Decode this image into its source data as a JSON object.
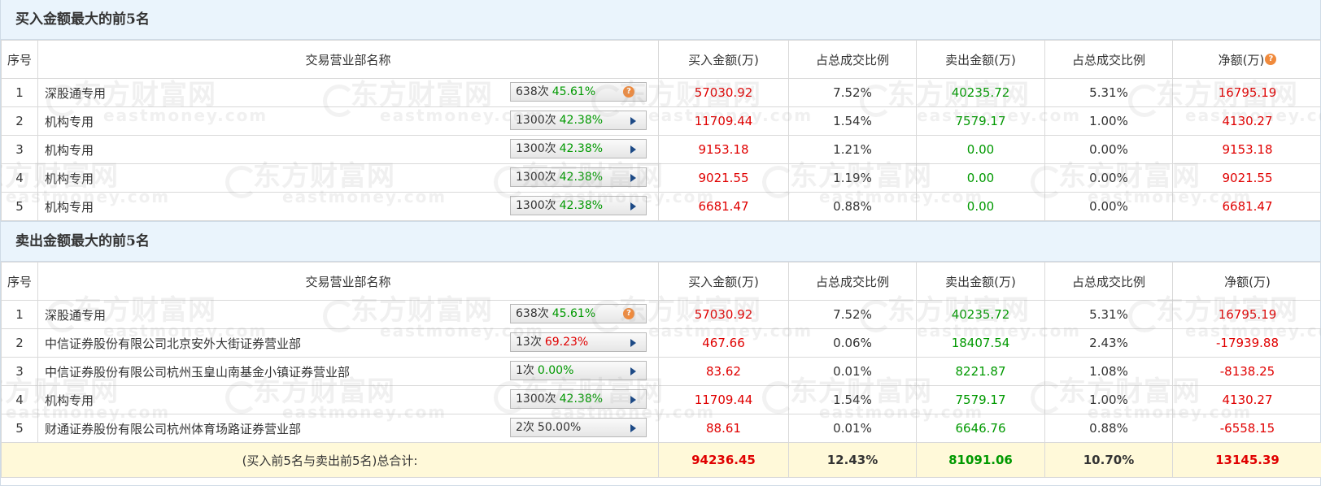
{
  "headers": {
    "seq": "序号",
    "name": "交易营业部名称",
    "buy": "买入金额(万)",
    "buy_ratio": "占总成交比例",
    "sell": "卖出金额(万)",
    "sell_ratio": "占总成交比例",
    "net": "净额(万)"
  },
  "buy_section": {
    "title": "买入金额最大的前5名",
    "rows": [
      {
        "seq": "1",
        "name": "深股通专用",
        "count": "638次",
        "pct": "45.61%",
        "pct_color": "green",
        "icon": "question-icon",
        "buy": "57030.92",
        "buy_ratio": "7.52%",
        "sell": "40235.72",
        "sell_ratio": "5.31%",
        "net": "16795.19"
      },
      {
        "seq": "2",
        "name": "机构专用",
        "count": "1300次",
        "pct": "42.38%",
        "pct_color": "green",
        "icon": "play-arrow-icon",
        "buy": "11709.44",
        "buy_ratio": "1.54%",
        "sell": "7579.17",
        "sell_ratio": "1.00%",
        "net": "4130.27"
      },
      {
        "seq": "3",
        "name": "机构专用",
        "count": "1300次",
        "pct": "42.38%",
        "pct_color": "green",
        "icon": "play-arrow-icon",
        "buy": "9153.18",
        "buy_ratio": "1.21%",
        "sell": "0.00",
        "sell_ratio": "0.00%",
        "net": "9153.18"
      },
      {
        "seq": "4",
        "name": "机构专用",
        "count": "1300次",
        "pct": "42.38%",
        "pct_color": "green",
        "icon": "play-arrow-icon",
        "buy": "9021.55",
        "buy_ratio": "1.19%",
        "sell": "0.00",
        "sell_ratio": "0.00%",
        "net": "9021.55"
      },
      {
        "seq": "5",
        "name": "机构专用",
        "count": "1300次",
        "pct": "42.38%",
        "pct_color": "green",
        "icon": "play-arrow-icon",
        "buy": "6681.47",
        "buy_ratio": "0.88%",
        "sell": "0.00",
        "sell_ratio": "0.00%",
        "net": "6681.47"
      }
    ]
  },
  "sell_section": {
    "title": "卖出金额最大的前5名",
    "rows": [
      {
        "seq": "1",
        "name": "深股通专用",
        "count": "638次",
        "pct": "45.61%",
        "pct_color": "green",
        "icon": "question-icon",
        "buy": "57030.92",
        "buy_ratio": "7.52%",
        "sell": "40235.72",
        "sell_ratio": "5.31%",
        "net": "16795.19"
      },
      {
        "seq": "2",
        "name": "中信证券股份有限公司北京安外大街证券营业部",
        "count": "13次",
        "pct": "69.23%",
        "pct_color": "red",
        "icon": "play-arrow-icon",
        "buy": "467.66",
        "buy_ratio": "0.06%",
        "sell": "18407.54",
        "sell_ratio": "2.43%",
        "net": "-17939.88"
      },
      {
        "seq": "3",
        "name": "中信证券股份有限公司杭州玉皇山南基金小镇证券营业部",
        "count": "1次",
        "pct": "0.00%",
        "pct_color": "green",
        "icon": "play-arrow-icon",
        "buy": "83.62",
        "buy_ratio": "0.01%",
        "sell": "8221.87",
        "sell_ratio": "1.08%",
        "net": "-8138.25"
      },
      {
        "seq": "4",
        "name": "机构专用",
        "count": "1300次",
        "pct": "42.38%",
        "pct_color": "green",
        "icon": "play-arrow-icon",
        "buy": "11709.44",
        "buy_ratio": "1.54%",
        "sell": "7579.17",
        "sell_ratio": "1.00%",
        "net": "4130.27"
      },
      {
        "seq": "5",
        "name": "财通证券股份有限公司杭州体育场路证券营业部",
        "count": "2次",
        "pct": "50.00%",
        "pct_color": "black",
        "icon": "play-arrow-icon",
        "buy": "88.61",
        "buy_ratio": "0.01%",
        "sell": "6646.76",
        "sell_ratio": "0.88%",
        "net": "-6558.15"
      }
    ]
  },
  "total": {
    "label": "(买入前5名与卖出前5名)总合计:",
    "buy": "94236.45",
    "buy_ratio": "12.43%",
    "sell": "81091.06",
    "sell_ratio": "10.70%",
    "net": "13145.39"
  },
  "watermark": {
    "cn": "东方财富网",
    "en": "eastmoney.com"
  },
  "colors": {
    "red": "#e00000",
    "green": "#009900",
    "header_bg": "#eaf4fc",
    "total_bg": "#fff9d9"
  }
}
